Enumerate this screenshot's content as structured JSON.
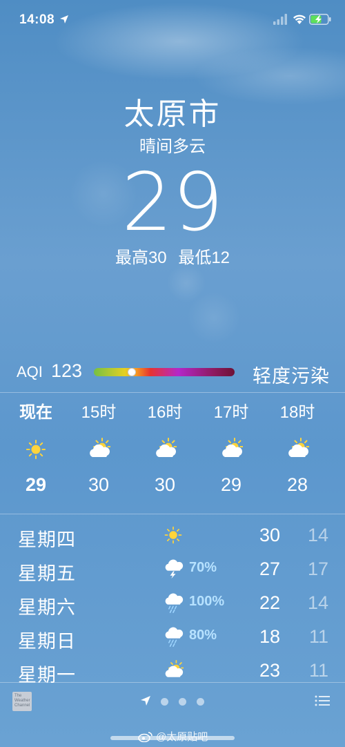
{
  "status_bar": {
    "time": "14:08"
  },
  "header": {
    "city": "太原市",
    "condition": "晴间多云",
    "temperature": "29",
    "high": "最高30",
    "low": "最低12"
  },
  "aqi": {
    "label": "AQI",
    "value": "123",
    "description": "轻度污染",
    "level_fraction": 0.27
  },
  "hourly": [
    {
      "label": "现在",
      "icon": "sun-icon",
      "temp": "29",
      "now": true
    },
    {
      "label": "15时",
      "icon": "partly-cloudy-icon",
      "temp": "30"
    },
    {
      "label": "16时",
      "icon": "partly-cloudy-icon",
      "temp": "30"
    },
    {
      "label": "17时",
      "icon": "partly-cloudy-icon",
      "temp": "29"
    },
    {
      "label": "18时",
      "icon": "partly-cloudy-icon",
      "temp": "28"
    }
  ],
  "daily": [
    {
      "day": "星期四",
      "icon": "sun-icon",
      "pop": "",
      "high": "30",
      "low": "14"
    },
    {
      "day": "星期五",
      "icon": "thunderstorm-icon",
      "pop": "70%",
      "high": "27",
      "low": "17"
    },
    {
      "day": "星期六",
      "icon": "rain-icon",
      "pop": "100%",
      "high": "22",
      "low": "14"
    },
    {
      "day": "星期日",
      "icon": "rain-icon",
      "pop": "80%",
      "high": "18",
      "low": "11"
    },
    {
      "day": "星期一",
      "icon": "partly-cloudy-icon",
      "pop": "",
      "high": "23",
      "low": "11"
    }
  ],
  "bottom_bar": {
    "logo_text": "The Weather Channel",
    "page_count": 3
  },
  "watermark": "@太原贴吧",
  "colors": {
    "background": "#5c97cd",
    "pop_text": "#b7e2ff",
    "sun": "#ffd43b"
  }
}
